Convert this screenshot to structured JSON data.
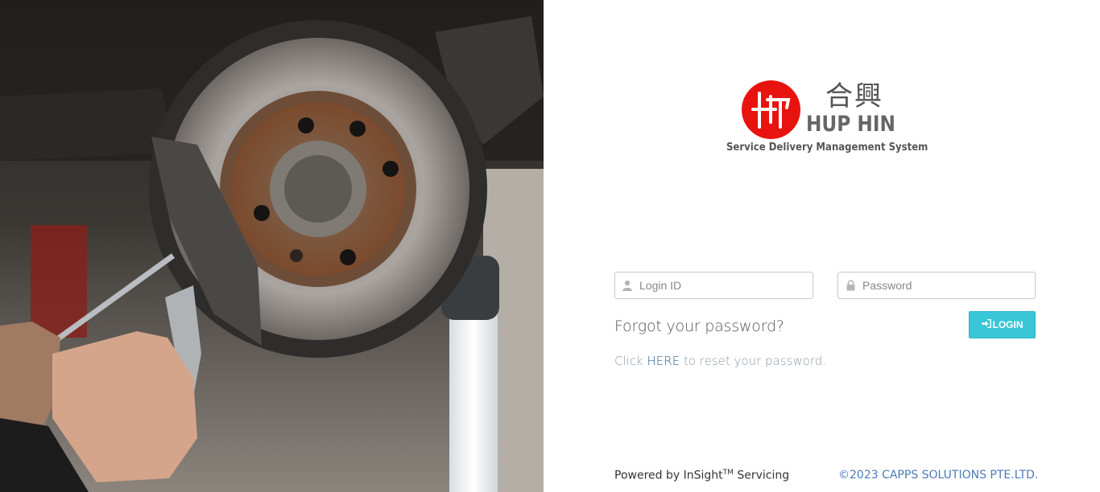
{
  "hero_image": {
    "subject": "mechanic-servicing-brake-disc"
  },
  "brand": {
    "monogram": "HH",
    "chinese_name": "合興",
    "name": "HUP HIN",
    "tagline": "Service Delivery Management System",
    "accent": "#e8130f"
  },
  "login_form": {
    "login_id": {
      "value": "",
      "placeholder": "Login ID",
      "icon": "user-icon"
    },
    "password": {
      "value": "",
      "placeholder": "Password",
      "icon": "lock-icon"
    },
    "forgot_heading": "Forgot your password?",
    "login_button": {
      "label": "LOGIN",
      "icon": "sign-in-icon",
      "color": "#39c6d6"
    },
    "reset": {
      "prefix": "Click ",
      "link_label": "HERE",
      "suffix": " to reset your password."
    }
  },
  "footer": {
    "powered_prefix": "Powered by InSight",
    "powered_superscript": "TM",
    "powered_suffix": " Servicing",
    "copyright": "©2023 CAPPS SOLUTIONS PTE.LTD."
  }
}
